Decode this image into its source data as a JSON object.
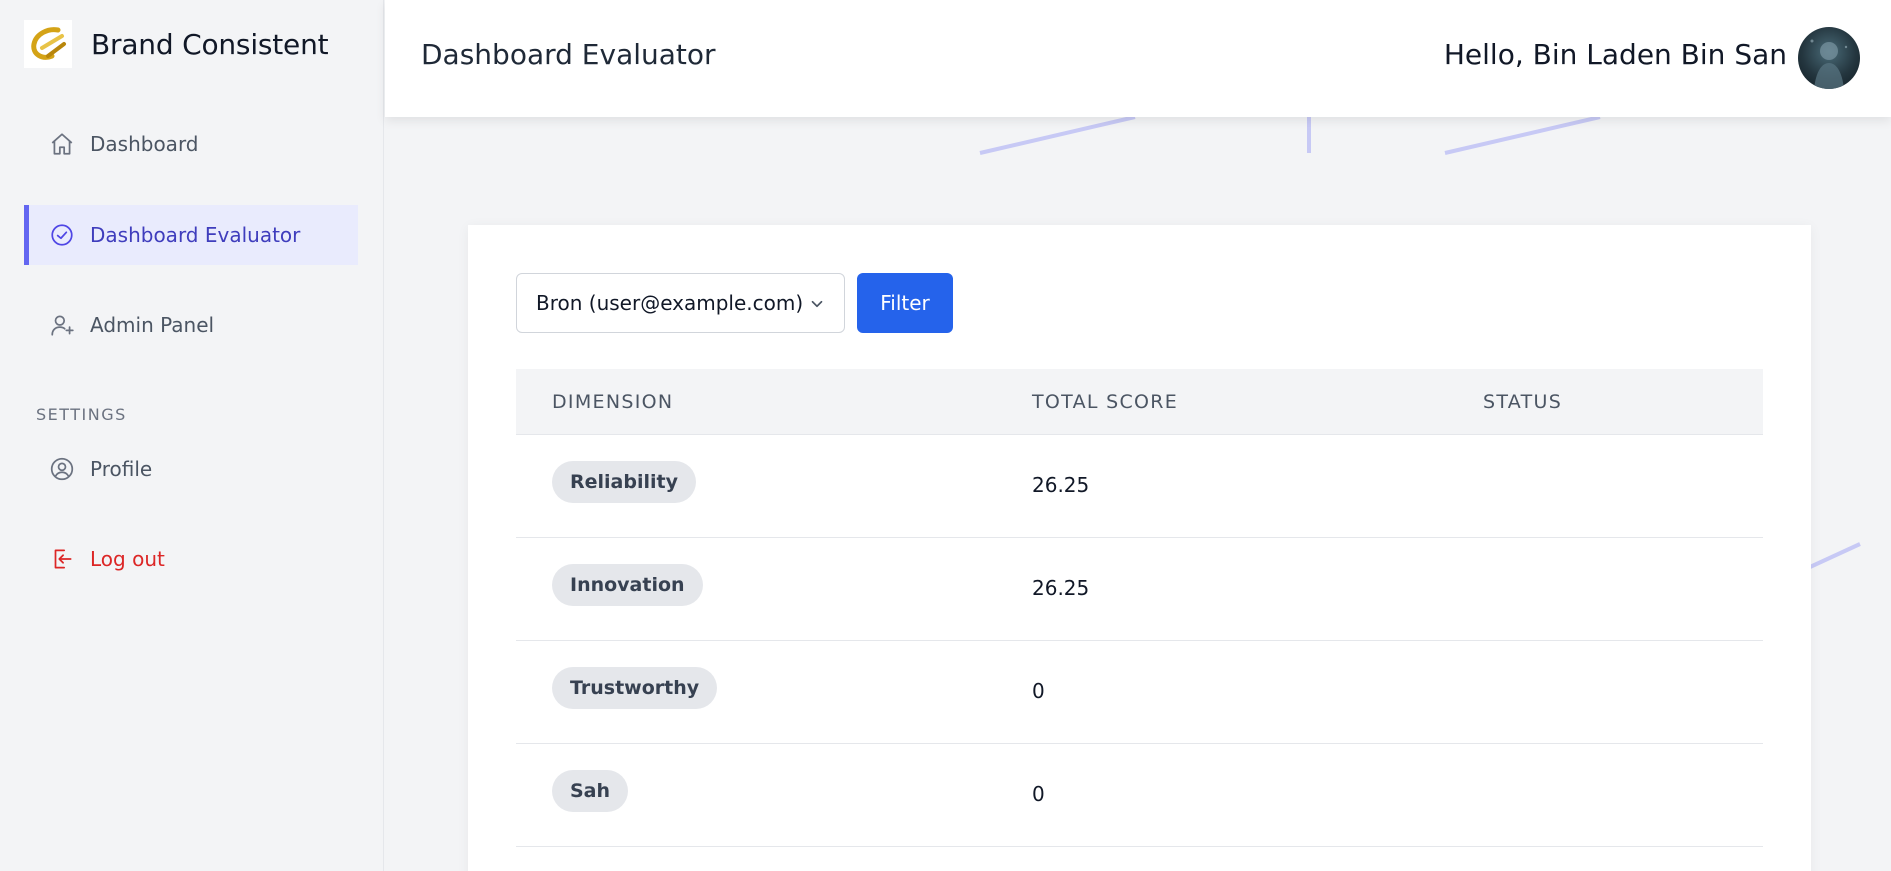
{
  "brand": {
    "name": "Brand Consistent"
  },
  "sidebar": {
    "items": [
      {
        "label": "Dashboard",
        "icon": "home-icon"
      },
      {
        "label": "Dashboard Evaluator",
        "icon": "check-badge-icon",
        "active": true
      },
      {
        "label": "Admin Panel",
        "icon": "user-plus-icon"
      }
    ],
    "settings_heading": "SETTINGS",
    "settings_items": [
      {
        "label": "Profile",
        "icon": "user-circle-icon"
      },
      {
        "label": "Log out",
        "icon": "logout-icon"
      }
    ]
  },
  "header": {
    "title": "Dashboard Evaluator",
    "greeting": "Hello, Bin Laden Bin San"
  },
  "filter": {
    "selected_user": "Bron (user@example.com)",
    "button_label": "Filter"
  },
  "table": {
    "columns": [
      "DIMENSION",
      "TOTAL SCORE",
      "STATUS"
    ],
    "rows": [
      {
        "dimension": "Reliability",
        "score": "26.25",
        "status": ""
      },
      {
        "dimension": "Innovation",
        "score": "26.25",
        "status": ""
      },
      {
        "dimension": "Trustworthy",
        "score": "0",
        "status": ""
      },
      {
        "dimension": "Sah",
        "score": "0",
        "status": ""
      }
    ]
  },
  "colors": {
    "accent": "#6366f1",
    "primary_button": "#2563eb",
    "logout": "#dc2626",
    "active_bg": "#e9ebfd"
  }
}
